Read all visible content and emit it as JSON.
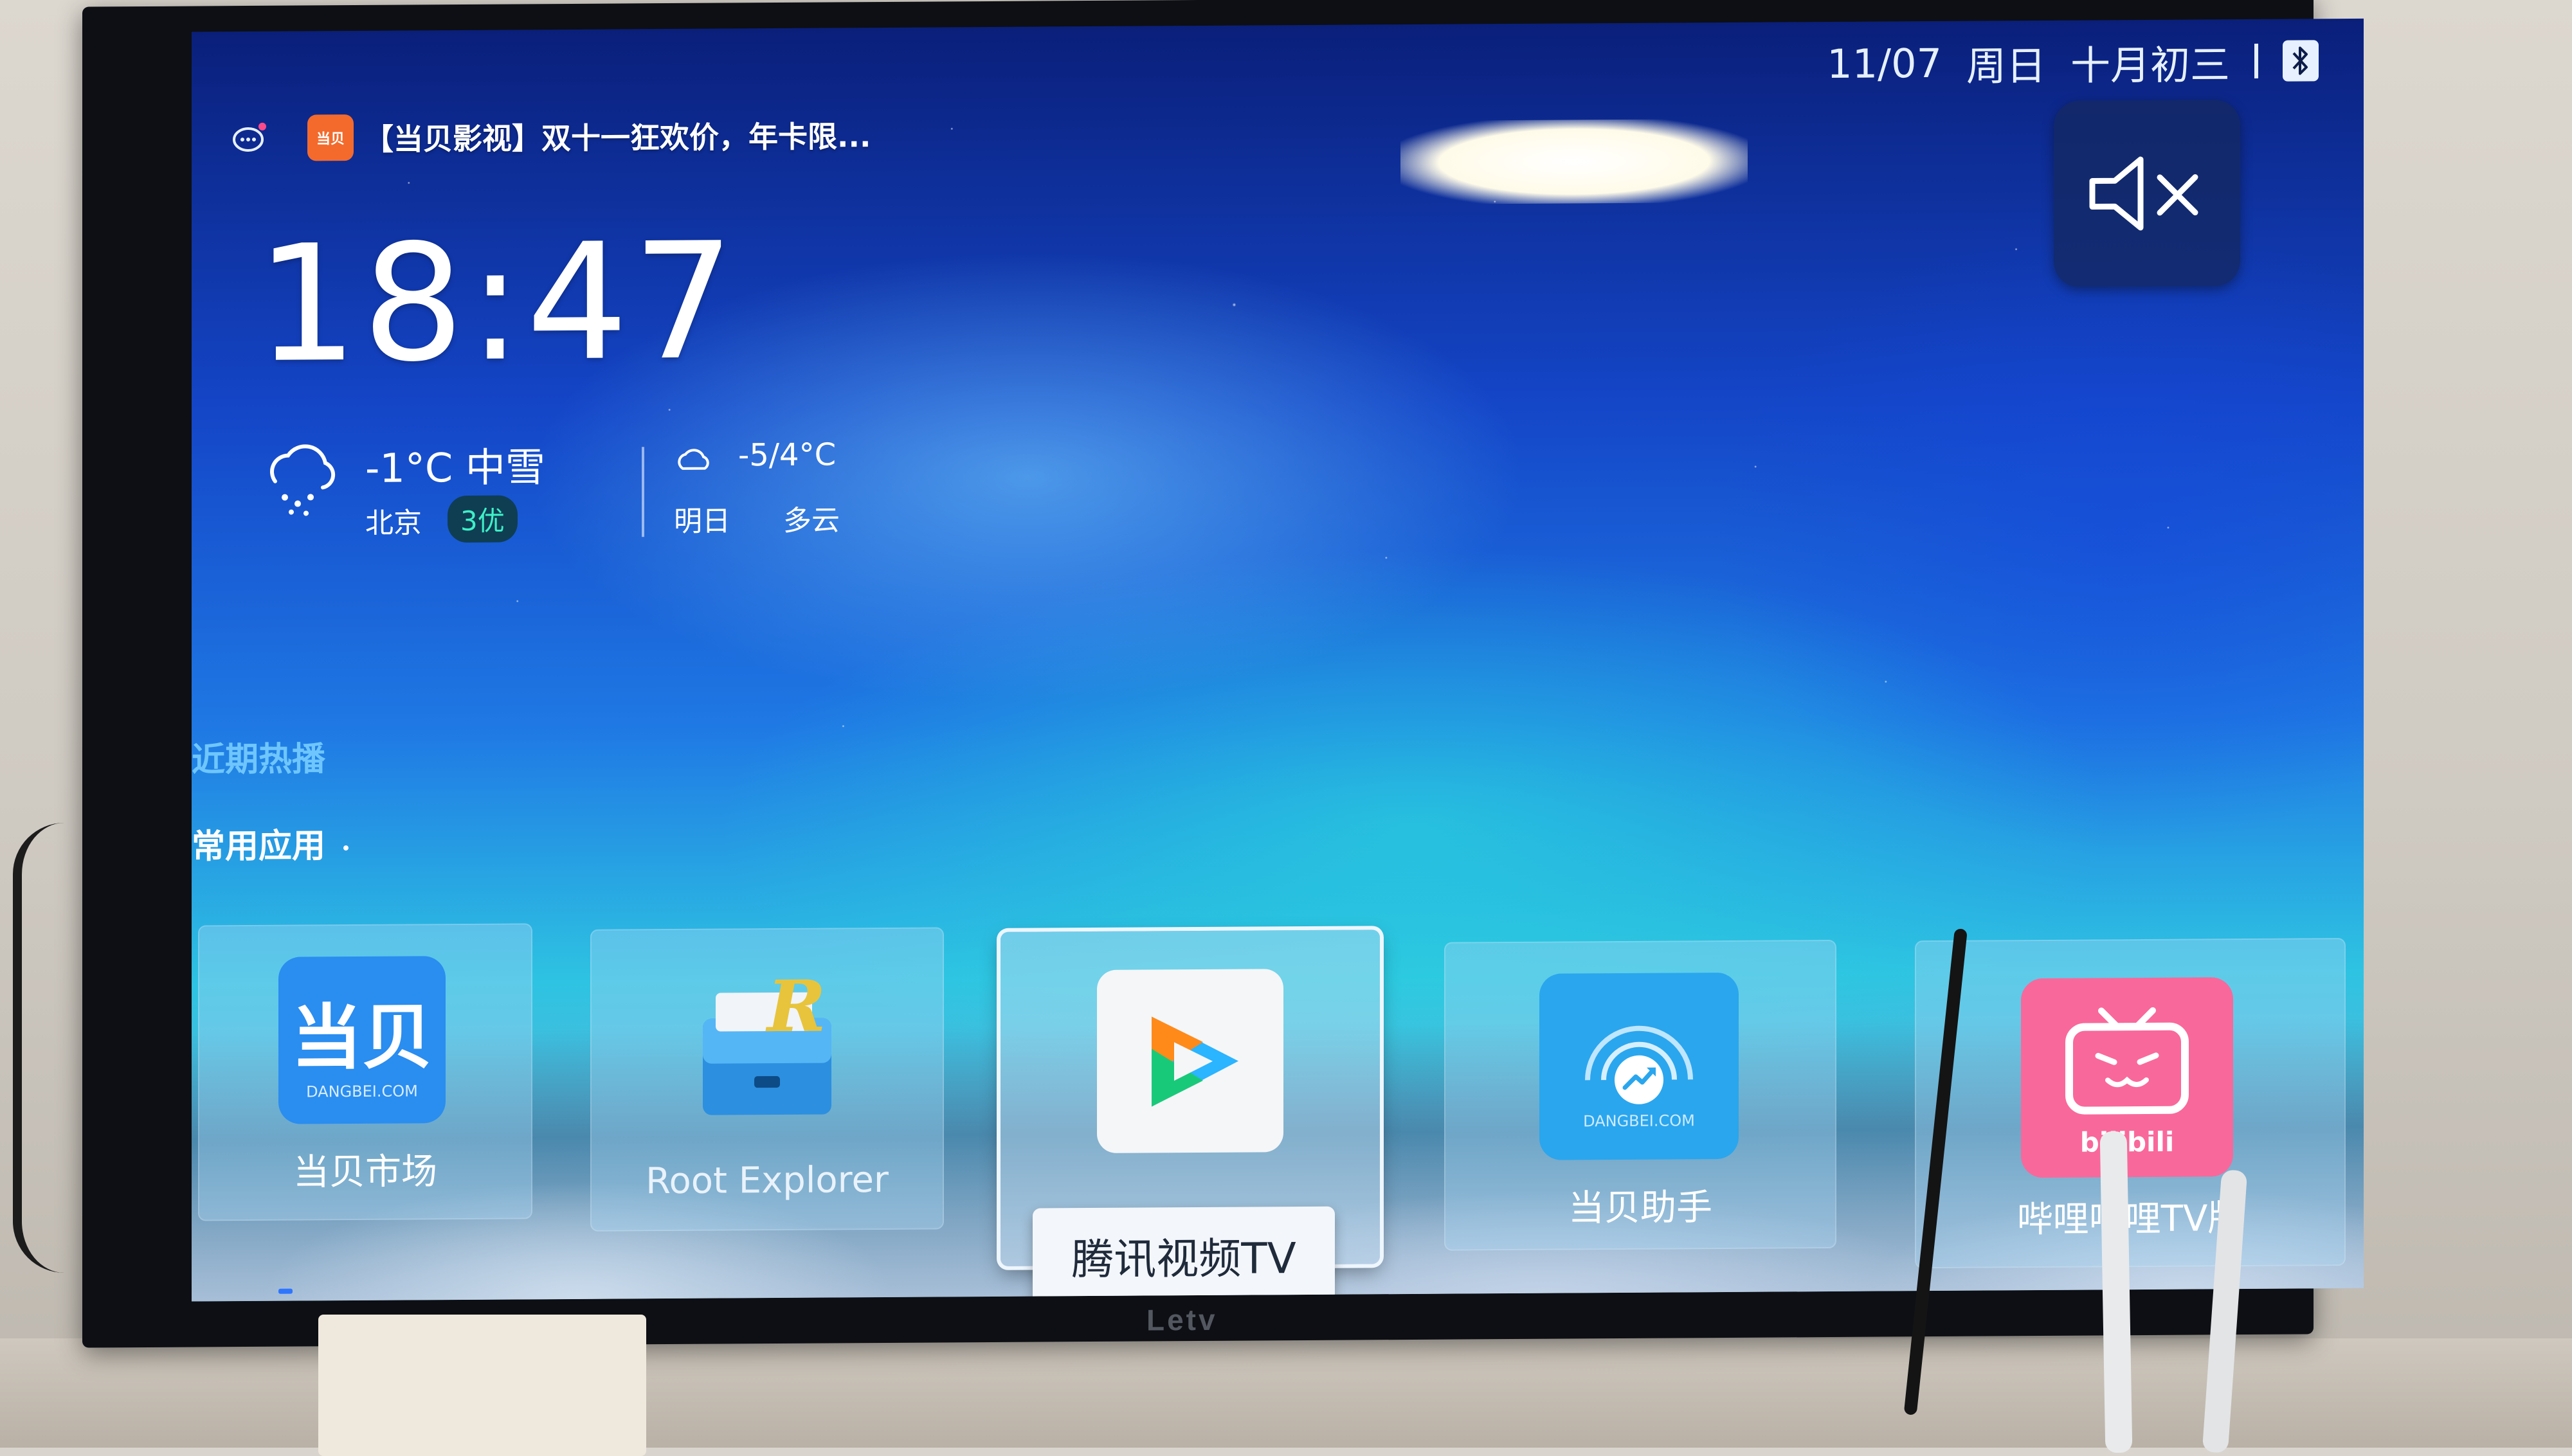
{
  "status_bar": {
    "date": "11/07",
    "weekday": "周日",
    "lunar": "十月初三"
  },
  "notification": {
    "app_badge": "当贝",
    "text": "【当贝影视】双十一狂欢价，年卡限..."
  },
  "clock": {
    "time": "18:47"
  },
  "weather": {
    "now_temp_cond": "-1°C 中雪",
    "city": "北京",
    "aqi": "3优",
    "tomorrow_temp": "-5/4°C",
    "tomorrow_label": "明日",
    "tomorrow_cond": "多云"
  },
  "sections": {
    "recent": "近期热播",
    "apps": "常用应用"
  },
  "apps": [
    {
      "label": "当贝市场",
      "icon_text": "当贝",
      "icon_sub": "DANGBEI.COM"
    },
    {
      "label": "Root Explorer",
      "icon_text": "R"
    },
    {
      "label": "腾讯视频TV"
    },
    {
      "label": "当贝助手",
      "icon_sub": "DANGBEI.COM"
    },
    {
      "label": "哔哩哔哩TV版",
      "icon_sub": "bilibili"
    }
  ],
  "tv_brand": "Letv",
  "colors": {
    "aqi_text": "#3ef0c7",
    "recent_section": "#6fc6ff",
    "dangbei_blue": "#2a8df0",
    "bilibili_pink": "#f9689b"
  }
}
